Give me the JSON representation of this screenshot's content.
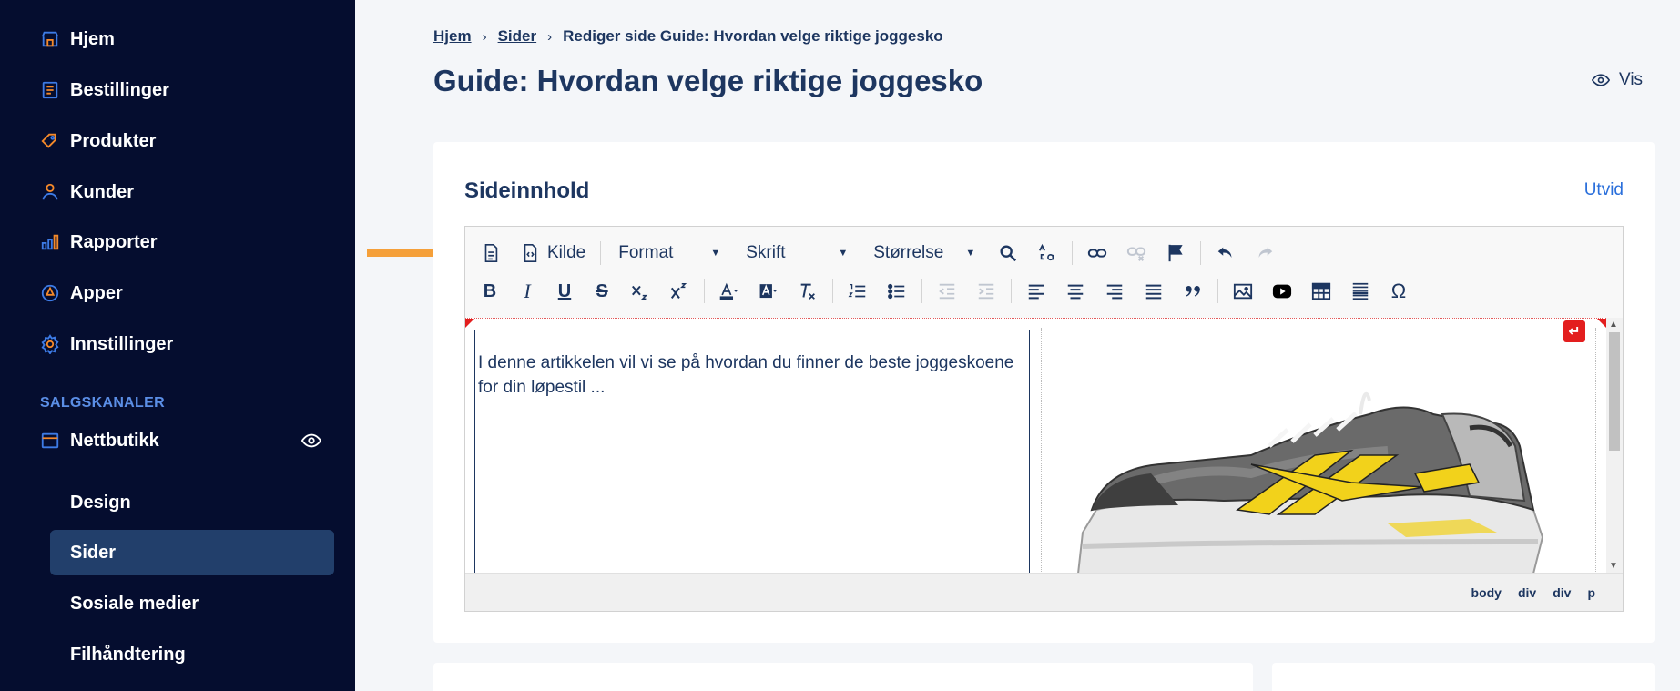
{
  "sidebar": {
    "items": [
      {
        "label": "Hjem",
        "icon": "store-icon"
      },
      {
        "label": "Bestillinger",
        "icon": "orders-icon"
      },
      {
        "label": "Produkter",
        "icon": "tag-icon"
      },
      {
        "label": "Kunder",
        "icon": "person-icon"
      },
      {
        "label": "Rapporter",
        "icon": "bar-chart-icon"
      },
      {
        "label": "Apper",
        "icon": "apps-icon"
      },
      {
        "label": "Innstillinger",
        "icon": "gear-icon"
      }
    ],
    "section_label": "SALGSKANALER",
    "channel": {
      "label": "Nettbutikk",
      "icon": "shop-icon"
    },
    "sub_items": [
      "Design",
      "Sider",
      "Sosiale medier",
      "Filhåndtering"
    ],
    "active_sub": "Sider",
    "colors": {
      "background": "#050d2f",
      "accent_orange": "#f5892a",
      "accent_blue": "#3d7be6",
      "active_bg": "#223f6b"
    }
  },
  "breadcrumb": {
    "home": "Hjem",
    "pages": "Sider",
    "current": "Rediger side Guide: Hvordan velge riktige joggesko"
  },
  "page": {
    "title": "Guide: Hvordan velge riktige joggesko",
    "view_label": "Vis"
  },
  "card": {
    "title": "Sideinnhold",
    "expand_label": "Utvid"
  },
  "editor": {
    "toolbar": {
      "source_label": "Kilde",
      "format_label": "Format",
      "font_label": "Skrift",
      "size_label": "Størrelse"
    },
    "content_text": "I denne artikkelen vil vi se på hvordan du finner de beste joggeskoene for din løpestil ...",
    "path": [
      "body",
      "div",
      "div",
      "p"
    ],
    "enter_glyph": "↵"
  }
}
